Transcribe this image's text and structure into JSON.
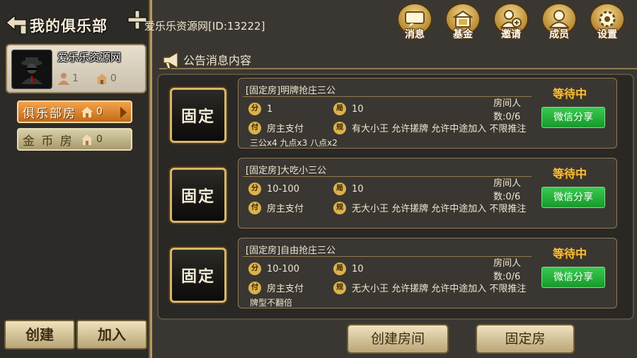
{
  "header": {
    "title": "我的俱乐部",
    "back_icon": "back-arrow-icon",
    "add_icon": "plus-icon"
  },
  "club_id_text": "爱乐乐资源网[ID:13222]",
  "profile": {
    "name": "爱乐乐资源网",
    "members": "1",
    "rooms": "0"
  },
  "tabs": [
    {
      "label": "俱乐部房",
      "count": "0",
      "active": true
    },
    {
      "label": "金 币 房",
      "count": "0",
      "active": false
    }
  ],
  "left_buttons": {
    "create": "创建",
    "join": "加入"
  },
  "top_icons": [
    {
      "label": "消息",
      "icon": "message-icon"
    },
    {
      "label": "基金",
      "icon": "fund-icon"
    },
    {
      "label": "邀请",
      "icon": "invite-icon"
    },
    {
      "label": "成员",
      "icon": "members-icon"
    },
    {
      "label": "设置",
      "icon": "settings-icon"
    }
  ],
  "announcement": {
    "label": "公告消息内容",
    "icon": "megaphone-icon"
  },
  "rooms": [
    {
      "fixed_label": "固定",
      "title": "[固定房]明牌抢庄三公",
      "status": "等待中",
      "share": "微信分享",
      "badges": {
        "score": "分",
        "rounds": "局",
        "pay": "付",
        "rule": "规"
      },
      "score": "1",
      "rounds": "10",
      "players": "房间人数:0/6",
      "pay": "房主支付",
      "rules": "有大小王 允许搓牌 允许中途加入 不限推注",
      "extra": "三公x4  九点x3  八点x2"
    },
    {
      "fixed_label": "固定",
      "title": "[固定房]大吃小三公",
      "status": "等待中",
      "share": "微信分享",
      "badges": {
        "score": "分",
        "rounds": "局",
        "pay": "付",
        "rule": "规"
      },
      "score": "10-100",
      "rounds": "10",
      "players": "房间人数:0/6",
      "pay": "房主支付",
      "rules": "无大小王 允许搓牌 允许中途加入 不限推注",
      "extra": ""
    },
    {
      "fixed_label": "固定",
      "title": "[固定房]自由抢庄三公",
      "status": "等待中",
      "share": "微信分享",
      "badges": {
        "score": "分",
        "rounds": "局",
        "pay": "付",
        "rule": "规"
      },
      "score": "10-100",
      "rounds": "10",
      "players": "房间人数:0/6",
      "pay": "房主支付",
      "rules": "无大小王 允许搓牌 允许中途加入 不限推注",
      "extra": "牌型不翻倍"
    }
  ],
  "footer": {
    "create_room": "创建房间",
    "fixed_room": "固定房"
  },
  "colors": {
    "accent_orange": "#e08a2e",
    "share_green": "#22b03a",
    "status_gold": "#f5c045",
    "frame_gold": "#b89a5c"
  }
}
